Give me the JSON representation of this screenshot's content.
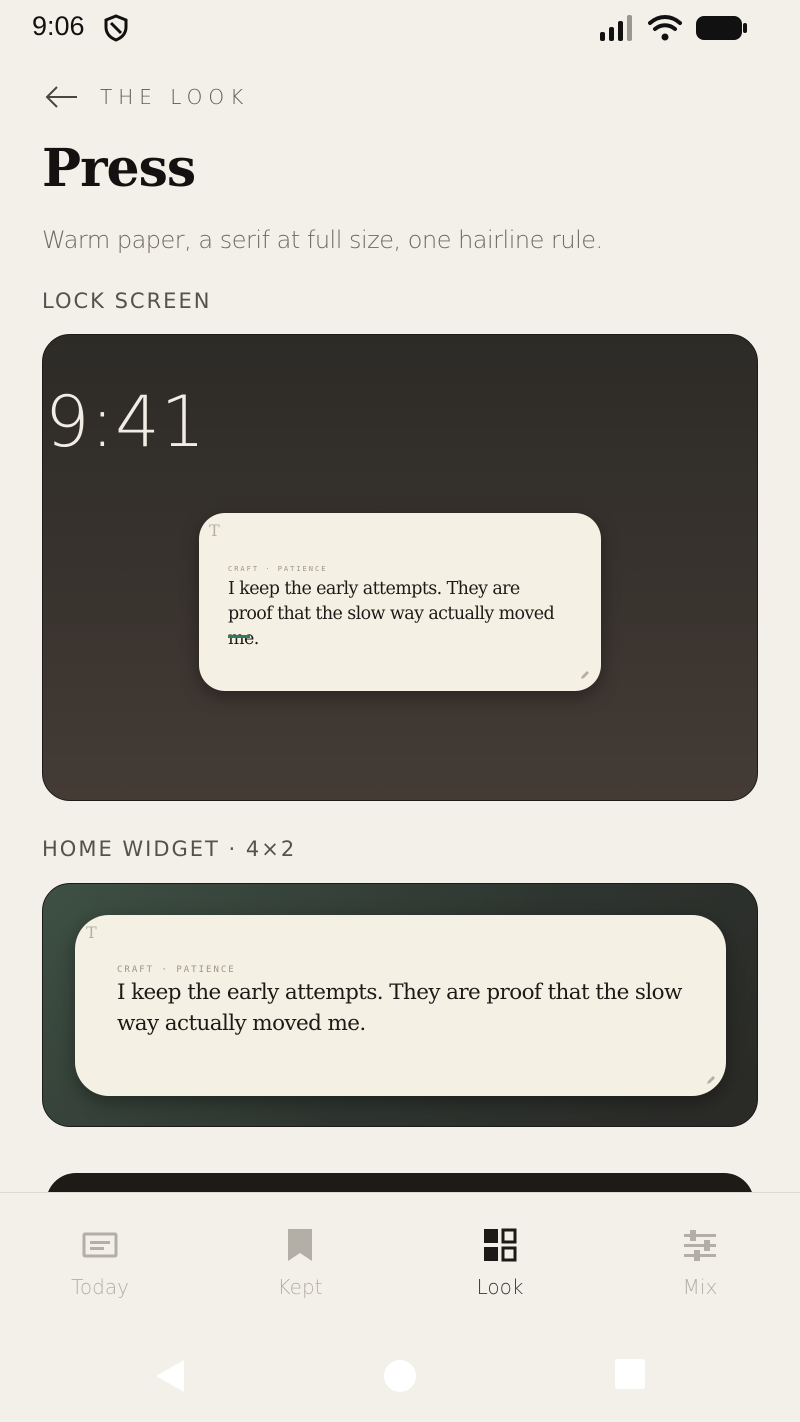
{
  "status_bar": {
    "time": "9:06"
  },
  "header": {
    "back_label": "THE LOOK",
    "title": "Press",
    "subtitle": "Warm paper, a serif at full size, one hairline rule."
  },
  "sections": {
    "lock_screen_label": "LOCK SCREEN",
    "home_widget_label": "HOME WIDGET · 4×2"
  },
  "lock_preview": {
    "clock": "9:41",
    "mark": "T",
    "meta": "CRAFT · PATIENCE",
    "quote": "I keep the early attempts. They are proof that the slow way actually moved me."
  },
  "home_preview": {
    "mark": "T",
    "meta": "CRAFT · PATIENCE",
    "quote": "I keep the early attempts. They are proof that the slow way actually moved me."
  },
  "bottom_nav": {
    "items": [
      {
        "label": "Today",
        "icon": "article-icon",
        "active": false
      },
      {
        "label": "Kept",
        "icon": "bookmark-icon",
        "active": false
      },
      {
        "label": "Look",
        "icon": "grid-icon",
        "active": true
      },
      {
        "label": "Mix",
        "icon": "sliders-icon",
        "active": false
      }
    ]
  },
  "colors": {
    "background": "#f3f0e9",
    "accent_rule": "#2f7a66",
    "card_paper": "#f4f0e4"
  }
}
